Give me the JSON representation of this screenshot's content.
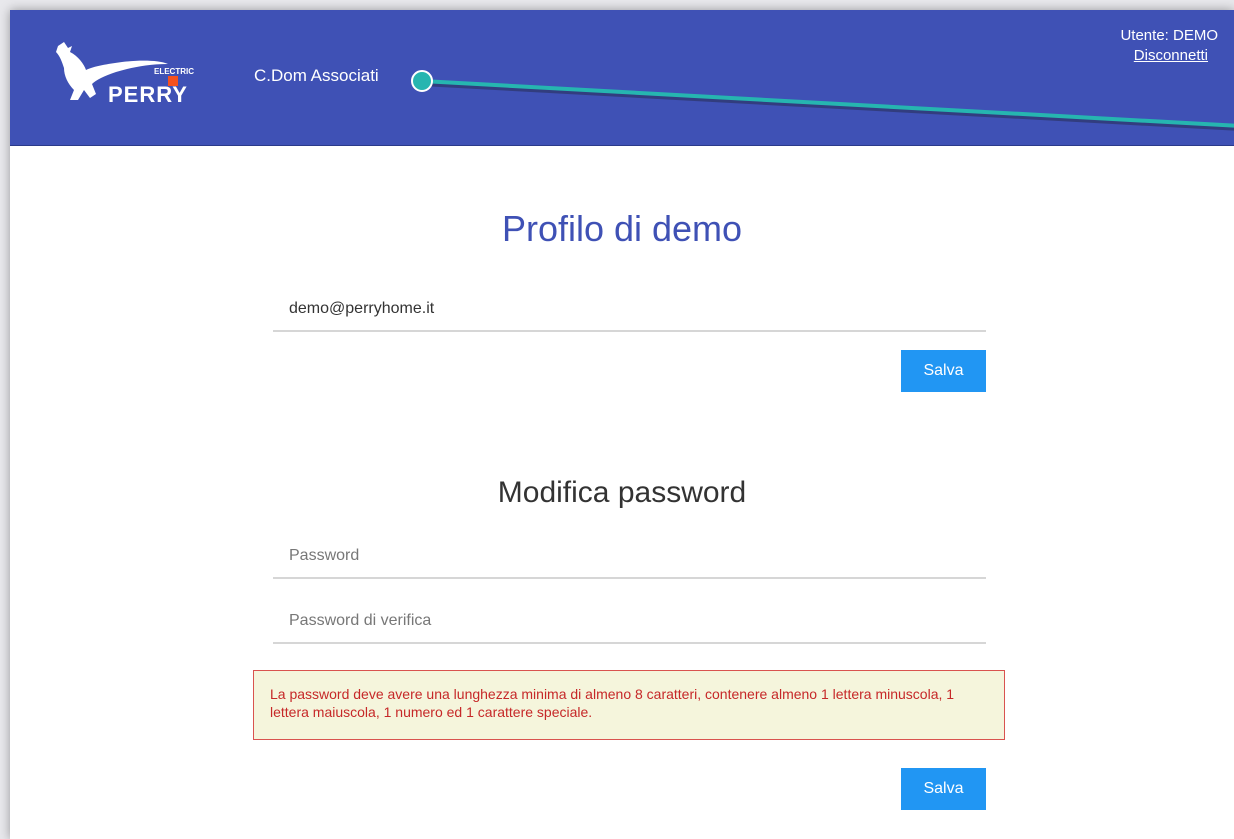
{
  "header": {
    "company_name": "C.Dom Associati",
    "logo": {
      "name": "perry-electric-logo",
      "brand_text": "PERRY",
      "sub_text": "ELECTRIC"
    },
    "user_label": "Utente: DEMO",
    "logout_label": "Disconnetti"
  },
  "profile": {
    "title": "Profilo di demo",
    "email_value": "demo@perryhome.it",
    "save_label": "Salva"
  },
  "password": {
    "title": "Modifica password",
    "password_placeholder": "Password",
    "verify_placeholder": "Password di verifica",
    "rules_message": "La password deve avere una lunghezza minima di almeno 8 caratteri, contenere almeno 1 lettera minuscola, 1 lettera maiuscola, 1 numero ed 1 carattere speciale.",
    "save_label": "Salva"
  },
  "colors": {
    "header_bg": "#3f51b5",
    "button_bg": "#2196f3",
    "alert_bg": "#f5f5dc",
    "alert_text": "#c62828",
    "annotation_line": "#26b5b0"
  }
}
